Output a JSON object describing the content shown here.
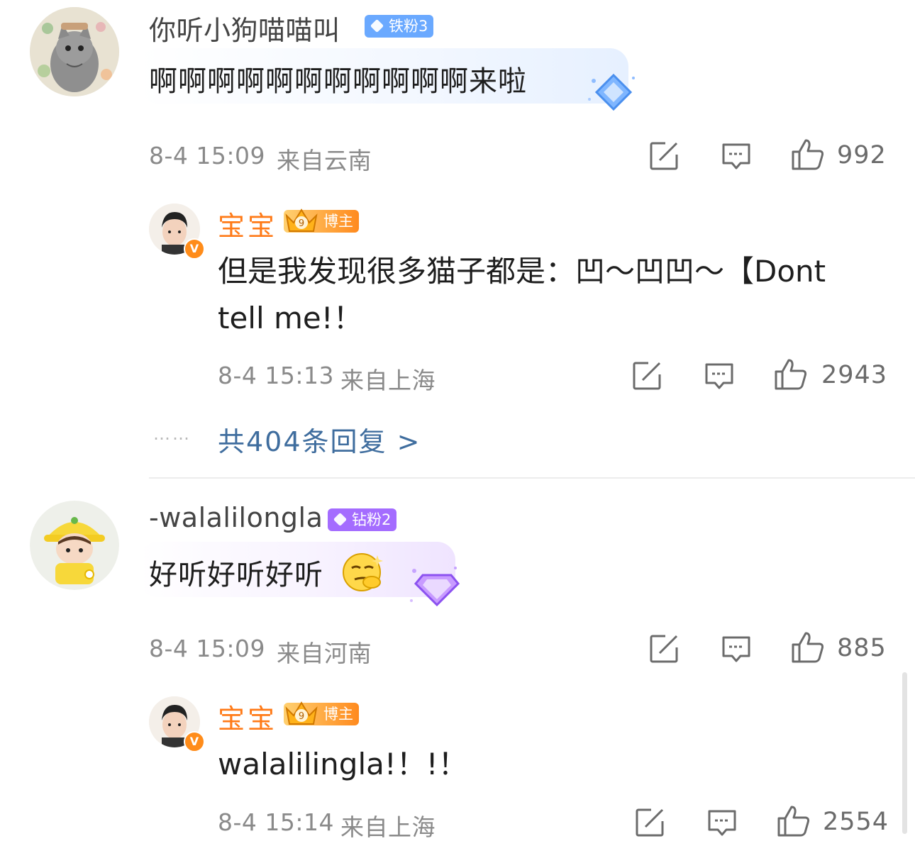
{
  "comments": [
    {
      "username": "你听小狗喵喵叫",
      "badge": "铁粉3",
      "text": "啊啊啊啊啊啊啊啊啊啊啊来啦",
      "time": "8-4 15:09",
      "location": "来自云南",
      "likes": "992",
      "reply": {
        "username": "宝宝",
        "badge": "博主",
        "level": "9",
        "text_line1": "但是我发现很多猫子都是：凹～凹凹～【Dont",
        "text_line2": "tell me!！",
        "time": "8-4 15:13",
        "location": "来自上海",
        "likes": "2943"
      },
      "more_dots": "……",
      "more_replies": "共404条回复 >"
    },
    {
      "username": "-walalilongla",
      "badge": "钻粉2",
      "text": "好听好听好听",
      "time": "8-4 15:09",
      "location": "来自河南",
      "likes": "885",
      "reply": {
        "username": "宝宝",
        "badge": "博主",
        "level": "9",
        "text_line1": "walalilingla!！!！",
        "time": "8-4 15:14",
        "location": "来自上海",
        "likes": "2554"
      }
    }
  ],
  "icons": {
    "share": "share-edit-icon",
    "comment": "comment-bubble-icon",
    "like": "thumbs-up-icon"
  },
  "colors": {
    "blogger_name": "#ff7a17",
    "more_link": "#3f6d9e",
    "iron_fan_badge": "#6aa9ff",
    "diamond_fan_badge": "#a46cff"
  }
}
